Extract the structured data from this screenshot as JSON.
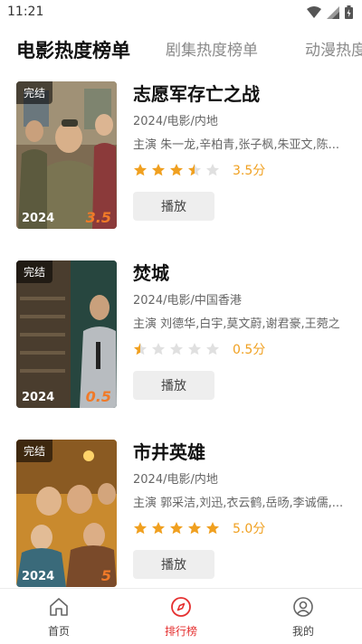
{
  "status": {
    "time": "11:21"
  },
  "tabs": [
    {
      "label": "电影热度榜单",
      "active": true
    },
    {
      "label": "剧集热度榜单",
      "active": false
    },
    {
      "label": "动漫热度",
      "active": false
    }
  ],
  "movies": [
    {
      "badge": "完结",
      "year": "2024",
      "poster_score": "3.5",
      "title": "志愿军存亡之战",
      "meta": "2024/电影/内地",
      "cast": "主演 朱一龙,辛柏青,张子枫,朱亚文,陈...",
      "stars": 3.5,
      "score_text": "3.5分",
      "play_label": "播放"
    },
    {
      "badge": "完结",
      "year": "2024",
      "poster_score": "0.5",
      "title": "焚城",
      "meta": "2024/电影/中国香港",
      "cast": "主演 刘德华,白宇,莫文蔚,谢君豪,王菀之",
      "stars": 0.5,
      "score_text": "0.5分",
      "play_label": "播放"
    },
    {
      "badge": "完结",
      "year": "2024",
      "poster_score": "5",
      "title": "市井英雄",
      "meta": "2024/电影/内地",
      "cast": "主演 郭采洁,刘迅,衣云鹤,岳旸,李诚儒,...",
      "stars": 5,
      "score_text": "5.0分",
      "play_label": "播放"
    }
  ],
  "bottom_nav": [
    {
      "label": "首页",
      "icon": "home-icon",
      "active": false
    },
    {
      "label": "排行榜",
      "icon": "compass-icon",
      "active": true
    },
    {
      "label": "我的",
      "icon": "user-icon",
      "active": false
    }
  ],
  "colors": {
    "accent": "#e53030",
    "star": "#f0a020",
    "star_empty": "#e0e0e0",
    "poster_score": "#f07a28"
  }
}
